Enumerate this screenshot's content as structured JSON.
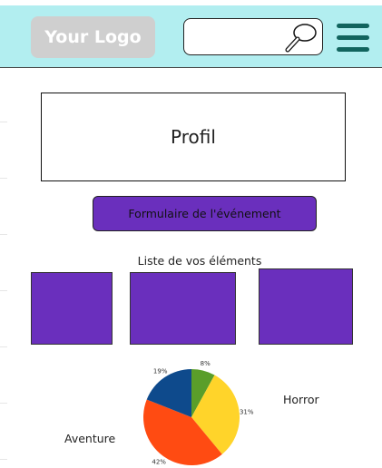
{
  "header": {
    "logo_text": "Your Logo",
    "search": {
      "placeholder": "",
      "value": ""
    }
  },
  "main": {
    "profile_label": "Profil",
    "form_button_label": "Formulaire de l'événement",
    "list_title": "Liste de vos éléments",
    "tiles": [
      {},
      {},
      {}
    ]
  },
  "chart_labels": {
    "horror": "Horror",
    "aventure": "Aventure"
  },
  "chart_data": {
    "type": "pie",
    "slices": [
      {
        "value": 8,
        "label": "8%",
        "color": "#5a9e2a"
      },
      {
        "value": 31,
        "label": "31%",
        "color": "#ffd42a"
      },
      {
        "value": 42,
        "label": "42%",
        "color": "#ff4b12"
      },
      {
        "value": 19,
        "label": "19%",
        "color": "#0e4a8c"
      }
    ],
    "start_angle_deg": -90
  },
  "colors": {
    "header_bg": "#b2eef0",
    "accent_purple": "#6a2fbd",
    "menu_teal": "#11645e"
  }
}
